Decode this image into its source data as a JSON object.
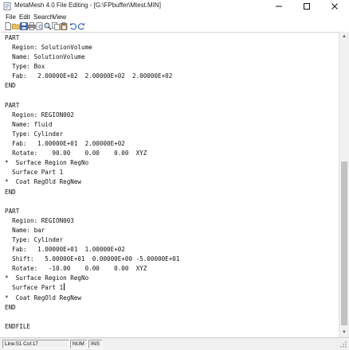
{
  "window": {
    "title": "MetaMesh 4.0 File Editing - [G:\\FPbuffer\\Mtest.MIN]"
  },
  "menu": {
    "items": [
      "File",
      "Edit",
      "Search",
      "View"
    ]
  },
  "toolbar": {
    "buttons": [
      "new-file",
      "open-folder",
      "save",
      "print",
      "print-preview",
      "find",
      "copy",
      "paste",
      "undo",
      "redo"
    ]
  },
  "editor": {
    "lines": [
      "PART",
      "  Region: SolutionVolume",
      "  Name: SolutionVolume",
      "  Type: Box",
      "  Fab:   2.00000E+02  2.00000E+02  2.00000E+02",
      "END",
      "",
      "PART",
      "  Region: REGION002",
      "  Name: fluid",
      "  Type: Cylinder",
      "  Fab:   1.00000E+01  2.00000E+02",
      "  Rotate:    90.00    0.00    0.00  XYZ",
      "*  Surface Region RegNo",
      "  Surface Part 1",
      "*  Coat RegOld RegNew",
      "END",
      "",
      "PART",
      "  Region: REGION003",
      "  Name: bar",
      "  Type: Cylinder",
      "  Fab:   1.00000E+01  1.00000E+02",
      "  Shift:   5.00000E+01  0.00000E+00 -5.00000E+01",
      "  Rotate:   -10.00    0.00    0.00  XYZ",
      "*  Surface Region RegNo",
      "  Surface Part 1",
      "*  Coat RegOld RegNew",
      "END",
      "",
      "ENDFILE"
    ]
  },
  "status": {
    "position": "Line:51  Col:17",
    "num": "NUM",
    "ins": "INS"
  }
}
